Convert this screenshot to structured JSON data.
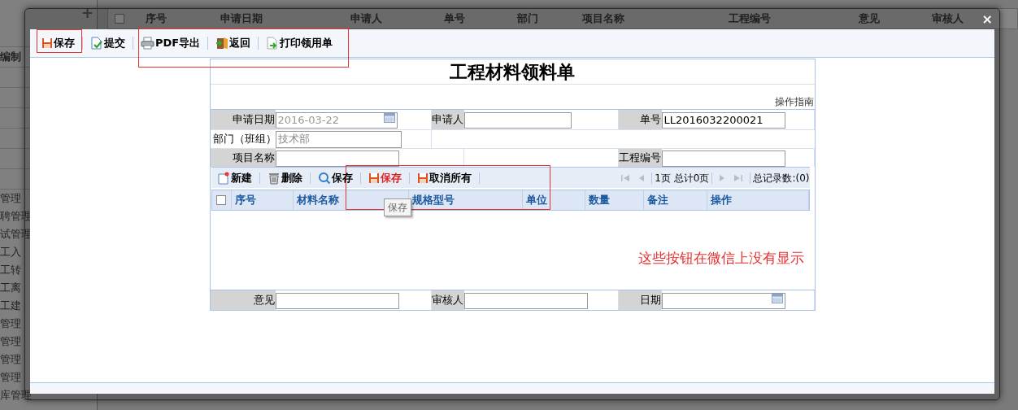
{
  "background": {
    "sidebar": {
      "add": "+",
      "section": "编制",
      "items": [
        {
          "label": "管理"
        },
        {
          "label": "聘管理"
        },
        {
          "label": "试管理"
        },
        {
          "label": "工入"
        },
        {
          "label": "工转"
        },
        {
          "label": "工离"
        },
        {
          "label": "工建"
        },
        {
          "label": "管理"
        },
        {
          "label": "管理"
        },
        {
          "label": "管理"
        },
        {
          "label": "管理"
        },
        {
          "label": "库管理"
        }
      ]
    },
    "grid_select_all_checked": false,
    "grid_columns": [
      "序号",
      "申请日期",
      "申请人",
      "单号",
      "部门",
      "项目名称",
      "工程编号",
      "意见",
      "审核人"
    ]
  },
  "dialog": {
    "close": "×",
    "toolbar": [
      {
        "label": "保存",
        "kind": "save"
      },
      {
        "label": "提交",
        "kind": "submit"
      },
      {
        "label": "PDF导出",
        "kind": "pdf"
      },
      {
        "label": "返回",
        "kind": "back"
      },
      {
        "label": "打印领用单",
        "kind": "print"
      }
    ],
    "form": {
      "title": "工程材料领料单",
      "guide_link": "操作指南",
      "row_1": [
        {
          "label": "申请日期",
          "value": "2016-03-22",
          "kind": "date",
          "disabled": true
        },
        {
          "label": "申请人",
          "kind": "text"
        },
        {
          "label": "单号",
          "value": "LL2016032200021",
          "kind": "text"
        }
      ],
      "department": {
        "label": "部门（班组）",
        "value": "技术部",
        "disabled": true
      },
      "row_3": [
        {
          "label": "项目名称",
          "kind": "text"
        },
        {
          "label": "工程编号",
          "kind": "text"
        }
      ],
      "grid_toolbar": [
        {
          "label": "新建",
          "kind": "new",
          "emphasis": false
        },
        {
          "label": "删除",
          "kind": "delete",
          "emphasis": false
        },
        {
          "label": "保存",
          "kind": "search",
          "emphasis": false
        },
        {
          "label": "保存",
          "kind": "save",
          "emphasis": true
        },
        {
          "label": "取消所有",
          "kind": "save",
          "emphasis": false
        }
      ],
      "pager": {
        "page": "1页 总计0页",
        "total": "总记录数:(0)"
      },
      "select_all_checked": false,
      "columns": [
        "序号",
        "材料名称",
        "规格型号",
        "单位",
        "数量",
        "备注",
        "操作"
      ],
      "tooltip": "保存",
      "footer_fields": [
        {
          "label": "意见",
          "kind": "text"
        },
        {
          "label": "审核人",
          "kind": "text"
        },
        {
          "label": "日期",
          "kind": "date"
        }
      ]
    },
    "annotation": "这些按钮在微信上没有显示"
  }
}
